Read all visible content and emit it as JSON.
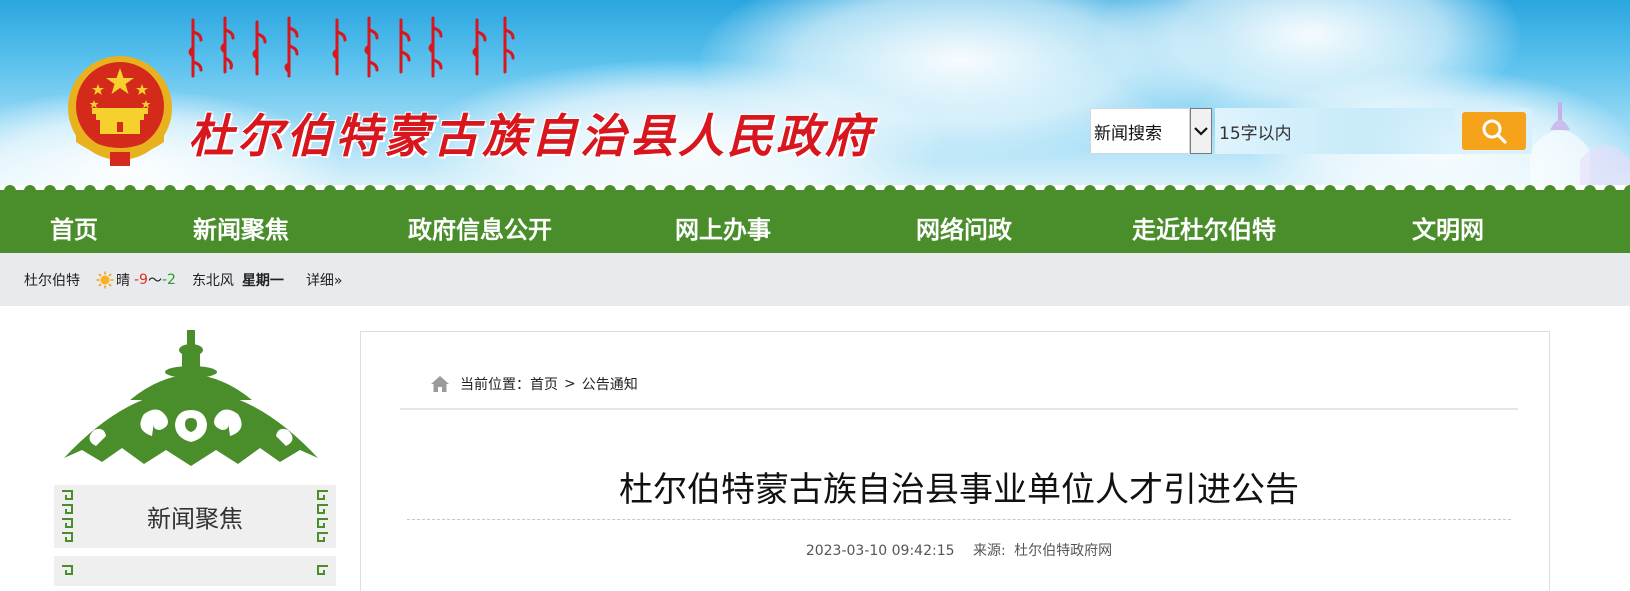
{
  "site": {
    "title": "杜尔伯特蒙古族自治县人民政府"
  },
  "search": {
    "select_value": "新闻搜索",
    "placeholder": "15字以内"
  },
  "nav": {
    "items": [
      {
        "label": "首页"
      },
      {
        "label": "新闻聚焦"
      },
      {
        "label": "政府信息公开"
      },
      {
        "label": "网上办事"
      },
      {
        "label": "网络问政"
      },
      {
        "label": "走近杜尔伯特"
      },
      {
        "label": "文明网"
      }
    ]
  },
  "weather": {
    "location": "杜尔伯特",
    "condition": "晴",
    "temp_low": "-9",
    "temp_sep": "～",
    "temp_high": "-2",
    "wind": "东北风",
    "weekday": "星期一",
    "detail_label": "详细»",
    "icon": "sun-icon"
  },
  "sidebar": {
    "items": [
      {
        "label": "新闻聚焦"
      },
      {
        "label": ""
      }
    ]
  },
  "breadcrumb": {
    "prefix": "当前位置：",
    "home": "首页",
    "separator": ">",
    "current": "公告通知"
  },
  "article": {
    "title": "杜尔伯特蒙古族自治县事业单位人才引进公告",
    "datetime": "2023-03-10 09:42:15",
    "source_label": "来源:",
    "source": "杜尔伯特政府网"
  },
  "colors": {
    "nav_green": "#4a8d2b",
    "title_red": "#d8161e",
    "search_orange": "#f5a31a",
    "temp_low": "#e0301e",
    "temp_high": "#2e9a2e"
  }
}
